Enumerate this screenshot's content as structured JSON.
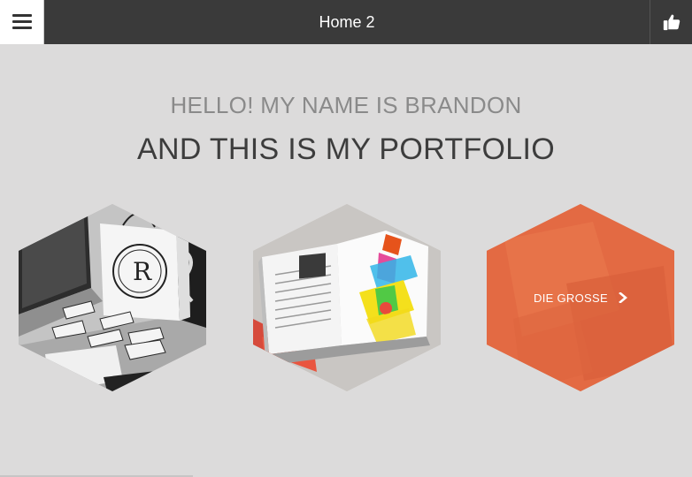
{
  "header": {
    "title": "Home 2",
    "menu_icon": "hamburger-menu-icon",
    "like_icon": "thumbs-up-icon"
  },
  "hero": {
    "greeting": "HELLO! MY NAME IS BRANDON",
    "subtitle": "AND THIS IS MY PORTFOLIO"
  },
  "portfolio": {
    "items": [
      {
        "image": "branding-stationery-photo"
      },
      {
        "image": "open-magazine-photo"
      },
      {
        "label": "DIE GROSSE",
        "icon": "chevron-right-icon"
      }
    ]
  },
  "colors": {
    "topbar": "#3a3a3a",
    "background": "#dcdbdb",
    "accent": "#e36a43"
  }
}
